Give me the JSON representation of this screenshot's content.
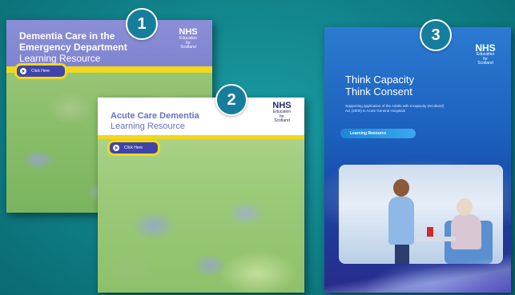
{
  "cards": [
    {
      "number": "1",
      "title": "Dementia Care in the Emergency Department",
      "subtitle": "Learning Resource",
      "button_label": "Click Here",
      "logo": {
        "mark": "NHS",
        "org_lines": [
          "Education",
          "for",
          "Scotland"
        ]
      }
    },
    {
      "number": "2",
      "title": "Acute Care Dementia",
      "subtitle": "Learning Resource",
      "button_label": "Click Here",
      "logo": {
        "mark": "NHS",
        "org_lines": [
          "Education",
          "for",
          "Scotland"
        ]
      }
    },
    {
      "number": "3",
      "title_line1": "Think Capacity",
      "title_line2": "Think Consent",
      "description": "Supporting application of the Adults with Incapacity (Scotland) Act (2000) in Acute General Hospitals",
      "badge_label": "Learning Resource",
      "logo": {
        "mark": "NHS",
        "org_lines": [
          "Education",
          "for",
          "Scotland"
        ]
      }
    }
  ],
  "colors": {
    "background": "#108088",
    "badge": "#167e9c",
    "yellow_band": "#f2d81c",
    "card1_header": "#7f83cf",
    "card3_blue": "#1b5cba"
  }
}
